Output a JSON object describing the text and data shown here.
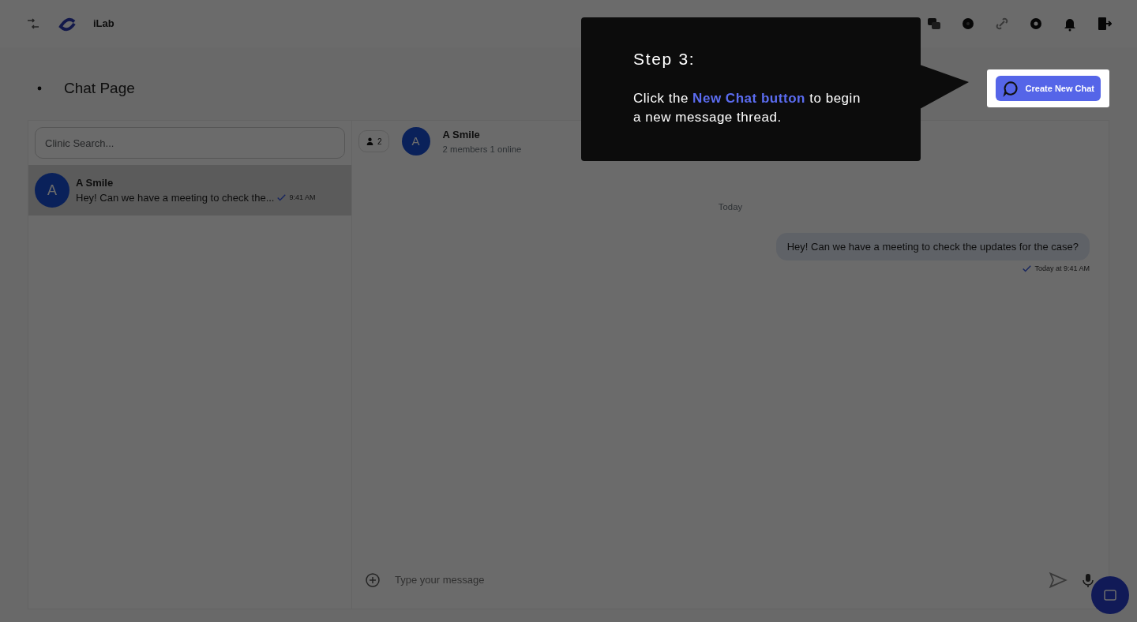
{
  "header": {
    "brand": "iLab"
  },
  "page": {
    "title": "Chat Page",
    "create_button": "Create New Chat"
  },
  "sidebar": {
    "search": {
      "placeholder": "Clinic Search..."
    },
    "conversations": [
      {
        "avatar": "A",
        "name": "A Smile",
        "preview": "Hey! Can we have a meeting to check the...",
        "time": "9:41 AM",
        "selected": true
      }
    ]
  },
  "chat": {
    "member_count": "2",
    "avatar": "A",
    "name": "A Smile",
    "status": "2 members 1 online",
    "date_divider": "Today",
    "messages": [
      {
        "text": "Hey! Can we have a meeting to check the updates for the case?",
        "time": "Today at 9:41 AM"
      }
    ],
    "composer": {
      "placeholder": "Type your message"
    }
  },
  "tour": {
    "title": "Step 3:",
    "body": "Click the **New Chat button** to begin a new message thread."
  }
}
